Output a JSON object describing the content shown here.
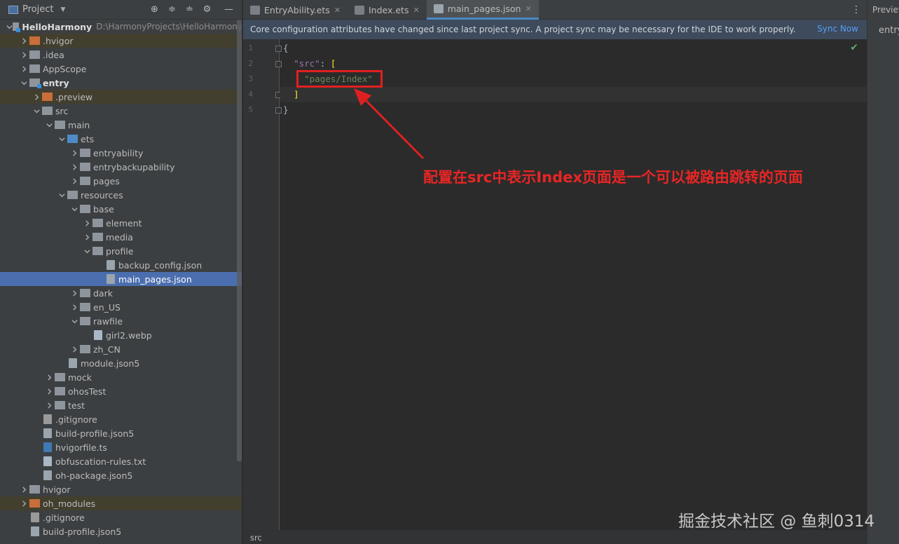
{
  "project_panel": {
    "title": "Project",
    "tools": [
      "target-icon",
      "expand-all-icon",
      "collapse-all-icon",
      "gear-icon",
      "minimize-icon"
    ]
  },
  "tree": [
    {
      "label": "HelloHarmony",
      "path": "D:\\HarmonyProjects\\HelloHarmony",
      "indent": 0,
      "arrow": "down",
      "icon": "module",
      "bold": true
    },
    {
      "label": ".hvigor",
      "indent": 1,
      "arrow": "right",
      "icon": "orange",
      "excluded": true
    },
    {
      "label": ".idea",
      "indent": 1,
      "arrow": "right",
      "icon": "grey"
    },
    {
      "label": "AppScope",
      "indent": 1,
      "arrow": "right",
      "icon": "grey"
    },
    {
      "label": "entry",
      "indent": 1,
      "arrow": "down",
      "icon": "module",
      "bold": true
    },
    {
      "label": ".preview",
      "indent": 2,
      "arrow": "right",
      "icon": "orange",
      "excluded": true
    },
    {
      "label": "src",
      "indent": 2,
      "arrow": "down",
      "icon": "grey"
    },
    {
      "label": "main",
      "indent": 3,
      "arrow": "down",
      "icon": "grey"
    },
    {
      "label": "ets",
      "indent": 4,
      "arrow": "down",
      "icon": "blue"
    },
    {
      "label": "entryability",
      "indent": 5,
      "arrow": "right",
      "icon": "grey"
    },
    {
      "label": "entrybackupability",
      "indent": 5,
      "arrow": "right",
      "icon": "grey"
    },
    {
      "label": "pages",
      "indent": 5,
      "arrow": "right",
      "icon": "grey"
    },
    {
      "label": "resources",
      "indent": 4,
      "arrow": "down",
      "icon": "grey"
    },
    {
      "label": "base",
      "indent": 5,
      "arrow": "down",
      "icon": "grey"
    },
    {
      "label": "element",
      "indent": 6,
      "arrow": "right",
      "icon": "grey"
    },
    {
      "label": "media",
      "indent": 6,
      "arrow": "right",
      "icon": "grey"
    },
    {
      "label": "profile",
      "indent": 6,
      "arrow": "down",
      "icon": "grey"
    },
    {
      "label": "backup_config.json",
      "indent": 7,
      "arrow": "none",
      "icon": "json"
    },
    {
      "label": "main_pages.json",
      "indent": 7,
      "arrow": "none",
      "icon": "json",
      "selected": true
    },
    {
      "label": "dark",
      "indent": 5,
      "arrow": "right",
      "icon": "grey"
    },
    {
      "label": "en_US",
      "indent": 5,
      "arrow": "right",
      "icon": "grey"
    },
    {
      "label": "rawfile",
      "indent": 5,
      "arrow": "down",
      "icon": "grey"
    },
    {
      "label": "girl2.webp",
      "indent": 6,
      "arrow": "none",
      "icon": "txt"
    },
    {
      "label": "zh_CN",
      "indent": 5,
      "arrow": "right",
      "icon": "grey"
    },
    {
      "label": "module.json5",
      "indent": 4,
      "arrow": "none",
      "icon": "json"
    },
    {
      "label": "mock",
      "indent": 3,
      "arrow": "right",
      "icon": "grey"
    },
    {
      "label": "ohosTest",
      "indent": 3,
      "arrow": "right",
      "icon": "grey"
    },
    {
      "label": "test",
      "indent": 3,
      "arrow": "right",
      "icon": "grey"
    },
    {
      "label": ".gitignore",
      "indent": 2,
      "arrow": "none",
      "icon": "git"
    },
    {
      "label": "build-profile.json5",
      "indent": 2,
      "arrow": "none",
      "icon": "json"
    },
    {
      "label": "hvigorfile.ts",
      "indent": 2,
      "arrow": "none",
      "icon": "ts"
    },
    {
      "label": "obfuscation-rules.txt",
      "indent": 2,
      "arrow": "none",
      "icon": "txt"
    },
    {
      "label": "oh-package.json5",
      "indent": 2,
      "arrow": "none",
      "icon": "json"
    },
    {
      "label": "hvigor",
      "indent": 1,
      "arrow": "right",
      "icon": "grey"
    },
    {
      "label": "oh_modules",
      "indent": 1,
      "arrow": "right",
      "icon": "orange",
      "excluded": true
    },
    {
      "label": ".gitignore",
      "indent": 1,
      "arrow": "none",
      "icon": "git"
    },
    {
      "label": "build-profile.json5",
      "indent": 1,
      "arrow": "none",
      "icon": "json"
    }
  ],
  "tabs": [
    {
      "label": "EntryAbility.ets",
      "icon": "ets",
      "active": false
    },
    {
      "label": "Index.ets",
      "icon": "ets",
      "active": false
    },
    {
      "label": "main_pages.json",
      "icon": "json",
      "active": true
    }
  ],
  "banner": {
    "message": "Core configuration attributes have changed since last project sync. A project sync may be necessary for the IDE to work properly.",
    "action": "Sync Now"
  },
  "code": {
    "line_numbers": [
      "1",
      "2",
      "3",
      "4",
      "5"
    ],
    "lines": [
      [
        {
          "t": "{",
          "c": "punc"
        }
      ],
      [
        {
          "t": "  ",
          "c": "punc"
        },
        {
          "t": "\"src\"",
          "c": "key"
        },
        {
          "t": ": ",
          "c": "punc"
        },
        {
          "t": "[",
          "c": "bracket"
        }
      ],
      [
        {
          "t": "    ",
          "c": "punc"
        },
        {
          "t": "\"pages/Index\"",
          "c": "str"
        }
      ],
      [
        {
          "t": "  ",
          "c": "punc"
        },
        {
          "t": "]",
          "c": "bracket"
        }
      ],
      [
        {
          "t": "}",
          "c": "punc"
        }
      ]
    ],
    "current_line": 4
  },
  "annotation": "配置在src中表示Index页面是一个可以被路由跳转的页面",
  "watermark": "掘金技术社区 @ 鱼刺0314",
  "breadcrumb": "src",
  "preview": {
    "title": "Previewer",
    "entry": "entry"
  }
}
